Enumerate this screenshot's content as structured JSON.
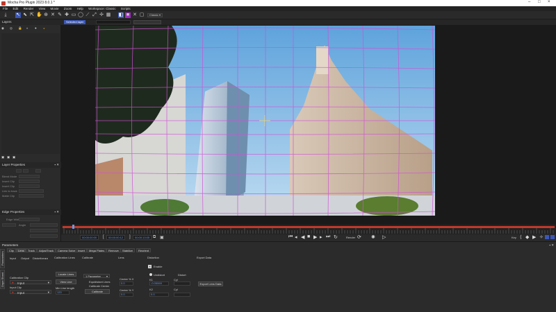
{
  "window": {
    "title": "Mocha Pro Plugin 2023 8.0.1 *"
  },
  "menu": [
    "File",
    "Edit",
    "Render",
    "View",
    "Movie",
    "Zoom",
    "Help",
    "Workspace: Classic",
    "Scripts"
  ],
  "toolbar": {
    "workspace_label": "Classic"
  },
  "layer_chip": "Selected layer",
  "panels": {
    "layers": "Layers",
    "layer_properties": "Layer Properties",
    "edge_properties": "Edge Properties",
    "parameters": "Parameters",
    "lp_rows": [
      "Blend Mode",
      "Insert Clip",
      "Insert Clip",
      "Link to track",
      "Matte Clip"
    ],
    "ep_rows": [
      "Edge Width",
      "Angle"
    ]
  },
  "timeline": {
    "in_time": "00:00:00:00",
    "current_time": "00:00:00:12",
    "out_time": "00:00:13:05",
    "render_label": "Render",
    "key_label": "Key"
  },
  "tabs": [
    "Clip",
    "Lens",
    "Track",
    "AdjustTrack",
    "Camera Solve",
    "Insert",
    "Mega Plates",
    "Remove",
    "Stabilize",
    "Reorient"
  ],
  "params": {
    "side_tabs": [
      "Parameters",
      "Dope Sheet"
    ],
    "subtabs": [
      "Input",
      "Output",
      "Distortion"
    ],
    "calibration_clip_label": "Calibration Clip",
    "calibration_clip_value": "Input",
    "input_clip_label": "Input Clip",
    "input_clip_value": "Input",
    "sections": [
      "Calibration Lines",
      "Calibrate",
      "Lens",
      "Distortion",
      "Export Data"
    ],
    "locate_lines": "Locate Lines",
    "view_line": "View Line",
    "min_line_length_label": "Min Line length",
    "min_line_length": "120",
    "parameters_dropdown": "1 Parameter",
    "equidistant_lines": "Equidistant Lines",
    "calibrate_center": "Calibrate Center",
    "calibrate_btn": "Calibrate",
    "center_x_label": "Center % X",
    "center_x": "0.0",
    "center_y_label": "Center % Y",
    "center_y": "0.0",
    "enable_label": "Enable",
    "undistort_label": "Undistort",
    "k1_label": "K1",
    "k1": "-0.05069",
    "k2_label": "K2",
    "k2": "0.0",
    "distort_label": "Distort",
    "cyl1_label": "Cyl",
    "cyl2_label": "Cyl",
    "export_lens_data": "Export Lens Data"
  },
  "colors": {
    "accent_blue": "#3a57b8",
    "accent_purple": "#a02bc4",
    "grid_magenta": "#d24fd8",
    "timeline_red": "#c0392b",
    "tracker_yellow": "#e3e07a"
  }
}
